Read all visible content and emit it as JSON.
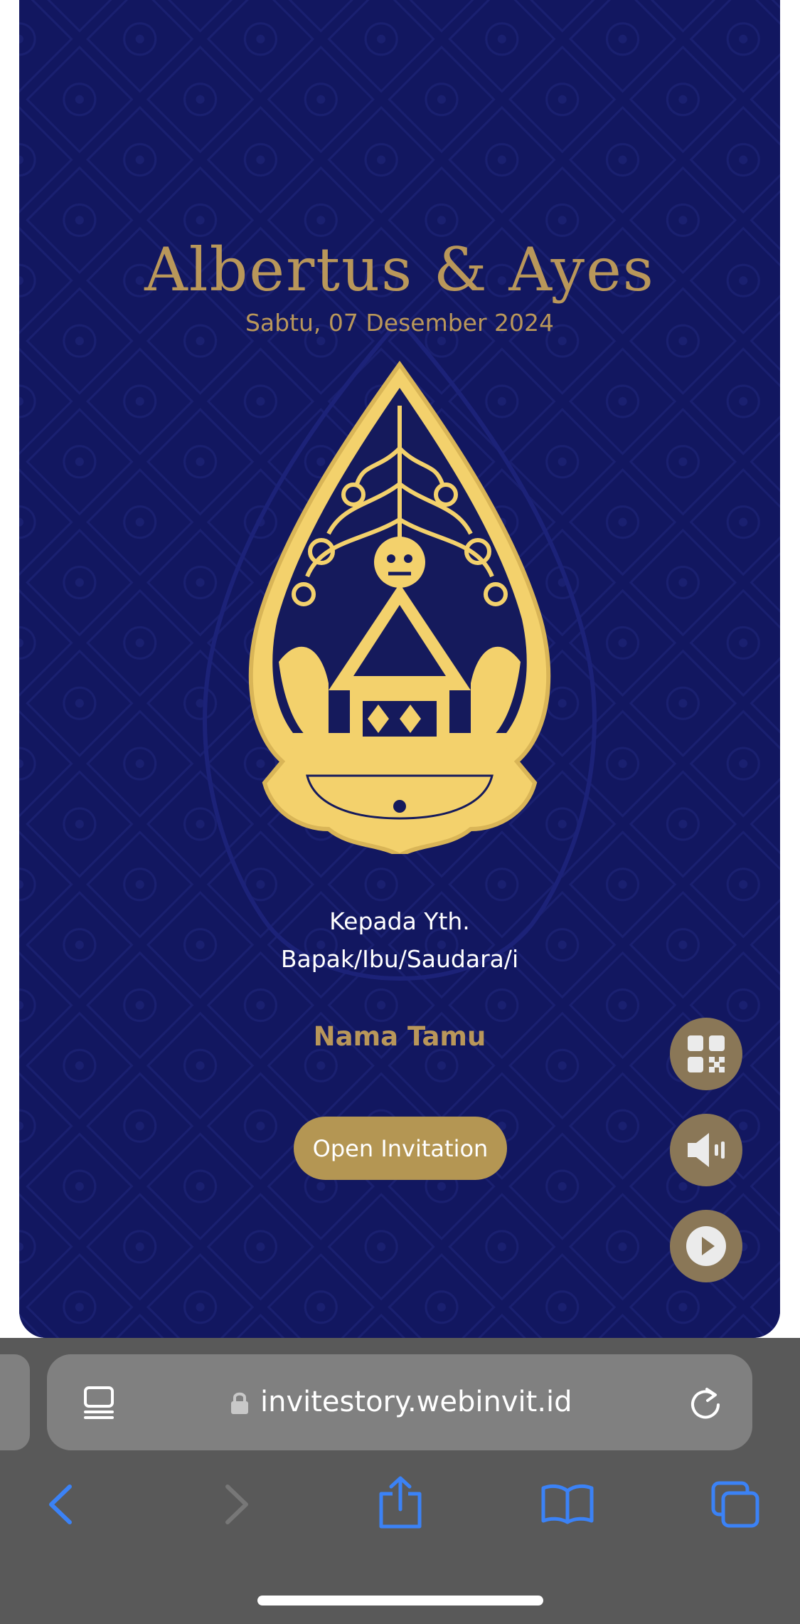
{
  "invitation": {
    "couple_names": "Albertus & Ayes",
    "date": "Sabtu, 07 Desember 2024",
    "greeting_line1": "Kepada Yth.",
    "greeting_line2": "Bapak/Ibu/Saudara/i",
    "guest_name": "Nama Tamu",
    "open_button": "Open Invitation",
    "colors": {
      "background": "#121760",
      "gold": "#b9975a",
      "button": "#b49653",
      "fab": "#8a7757"
    }
  },
  "floating_buttons": [
    {
      "icon": "qr-code-icon"
    },
    {
      "icon": "speaker-icon"
    },
    {
      "icon": "play-icon"
    }
  ],
  "browser": {
    "url": "invitestory.webinvit.id",
    "accent": "#3b82f6",
    "icons": [
      "reader-icon",
      "lock-icon",
      "reload-icon",
      "back-icon",
      "forward-icon",
      "share-icon",
      "bookmarks-icon",
      "tabs-icon"
    ]
  }
}
